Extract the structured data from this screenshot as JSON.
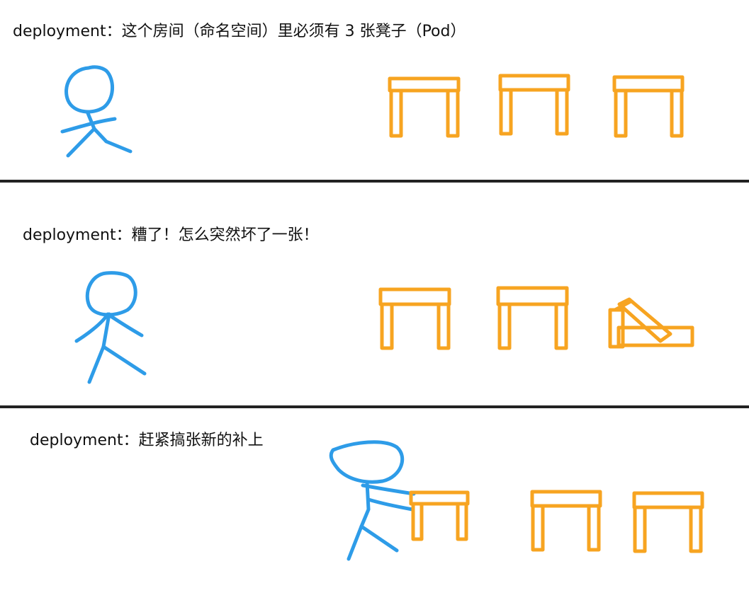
{
  "colors": {
    "person": "#2e9ce8",
    "stool": "#f7a421",
    "text": "#111111",
    "divider": "#222222"
  },
  "panels": [
    {
      "caption": "deployment：这个房间（命名空间）里必须有 3 张凳子（Pod）"
    },
    {
      "caption": "deployment：糟了！怎么突然坏了一张！"
    },
    {
      "caption": "deployment：赶紧搞张新的补上"
    }
  ]
}
